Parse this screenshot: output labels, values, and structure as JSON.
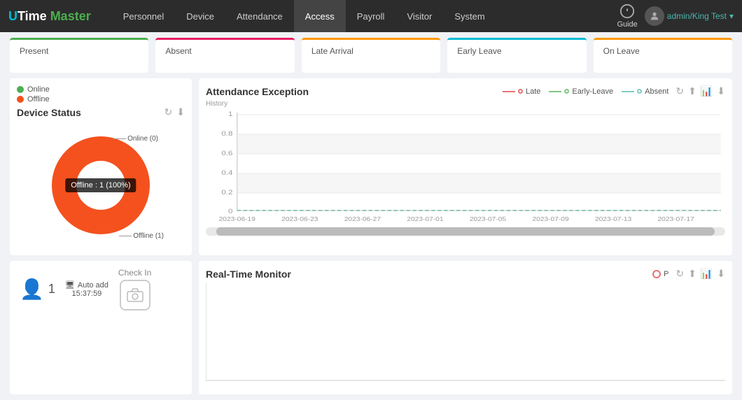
{
  "nav": {
    "logo": {
      "u": "U",
      "time": "Time ",
      "master": "Master"
    },
    "items": [
      {
        "label": "Personnel",
        "id": "personnel"
      },
      {
        "label": "Device",
        "id": "device"
      },
      {
        "label": "Attendance",
        "id": "attendance"
      },
      {
        "label": "Access",
        "id": "access",
        "active": true
      },
      {
        "label": "Payroll",
        "id": "payroll"
      },
      {
        "label": "Visitor",
        "id": "visitor"
      },
      {
        "label": "System",
        "id": "system"
      }
    ],
    "guide_label": "Guide",
    "user": "admin/King Test"
  },
  "stats": [
    {
      "label": "Present",
      "type": "present"
    },
    {
      "label": "Absent",
      "type": "absent"
    },
    {
      "label": "Late Arrival",
      "type": "late"
    },
    {
      "label": "Early Leave",
      "type": "early-leave"
    },
    {
      "label": "On Leave",
      "type": "on-leave"
    }
  ],
  "device_status": {
    "title": "Device Status",
    "legend": [
      {
        "label": "Online",
        "type": "online"
      },
      {
        "label": "Offline",
        "type": "offline"
      }
    ],
    "online_label": "Online (0)",
    "offline_label": "Offline (1)",
    "tooltip": "Offline : 1 (100%)",
    "online_count": 0,
    "offline_count": 1,
    "total": 1
  },
  "attendance_exception": {
    "title": "Attendance Exception",
    "history_label": "History",
    "legend": [
      {
        "label": "Late",
        "color": "#e57373"
      },
      {
        "label": "Early-Leave",
        "color": "#81c784"
      },
      {
        "label": "Absent",
        "color": "#80cbc4"
      }
    ],
    "y_axis": [
      "1",
      "0.8",
      "0.6",
      "0.4",
      "0.2",
      "0"
    ],
    "x_axis": [
      "2023-06-19",
      "2023-06-23",
      "2023-06-27",
      "2023-07-01",
      "2023-07-05",
      "2023-07-09",
      "2023-07-13",
      "2023-07-17"
    ]
  },
  "activity": {
    "count": "1",
    "auto_add_label": "Auto add",
    "auto_add_time": "15:37:59",
    "checkin_label": "Check In"
  },
  "real_time_monitor": {
    "title": "Real-Time Monitor",
    "legend_p": "P"
  }
}
